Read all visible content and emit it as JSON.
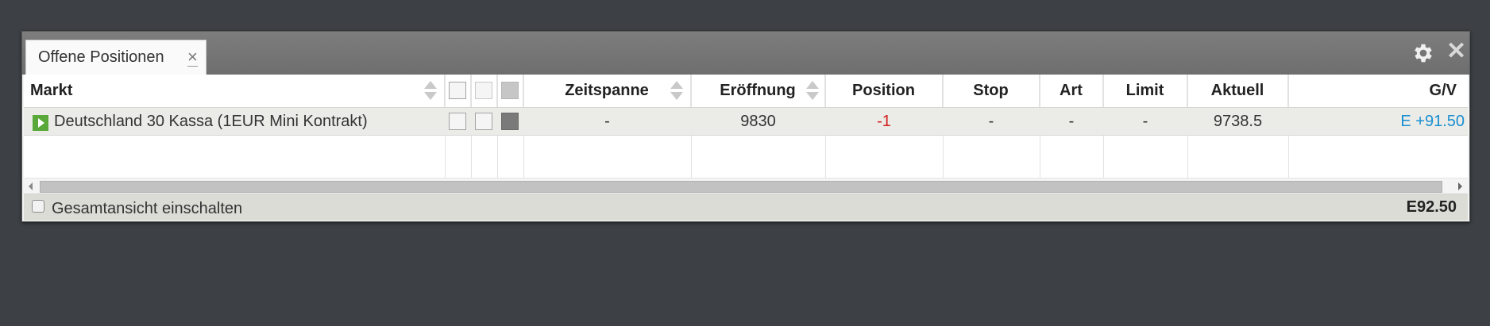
{
  "tab": {
    "label": "Offene Positionen",
    "close_glyph": "×"
  },
  "window": {
    "close_glyph": "✕"
  },
  "columns": {
    "markt": "Markt",
    "zeitspanne": "Zeitspanne",
    "eroeffnung": "Eröffnung",
    "position": "Position",
    "stop": "Stop",
    "art": "Art",
    "limit": "Limit",
    "aktuell": "Aktuell",
    "gv": "G/V"
  },
  "rows": [
    {
      "markt": "Deutschland 30 Kassa (1EUR Mini Kontrakt)",
      "zeitspanne": "-",
      "eroeffnung": "9830",
      "position": "-1",
      "stop": "-",
      "art": "-",
      "limit": "-",
      "aktuell": "9738.5",
      "gv": "E +91.50"
    }
  ],
  "footer": {
    "checkbox_label": "Gesamtansicht einschalten",
    "checked": false,
    "total": "E92.50"
  },
  "colors": {
    "negative": "#d32020",
    "profit": "#1a8fd1",
    "status_play": "#58a83a"
  },
  "icons": [
    "gear-icon",
    "close-icon",
    "news-icon",
    "chart-icon",
    "dropdown-icon",
    "play-icon",
    "sort-icon"
  ]
}
